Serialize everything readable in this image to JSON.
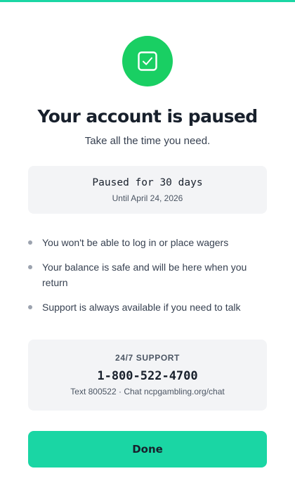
{
  "colors": {
    "accent": "#1ad6a4",
    "success": "#19cf63",
    "card_background": "#f3f4f6",
    "text_primary": "#18202c"
  },
  "header": {
    "icon": "check-square-icon",
    "title": "Your account is paused",
    "subtitle": "Take all the time you need."
  },
  "pause": {
    "duration": "Paused for 30 days",
    "until": "Until April 24, 2026"
  },
  "notes": [
    "You won't be able to log in or place wagers",
    "Your balance is safe and will be here when you return",
    "Support is always available if you need to talk"
  ],
  "support": {
    "label": "24/7 SUPPORT",
    "phone": "1-800-522-4700",
    "alternatives": "Text 800522 · Chat ncpgambling.org/chat"
  },
  "actions": {
    "done_label": "Done"
  }
}
